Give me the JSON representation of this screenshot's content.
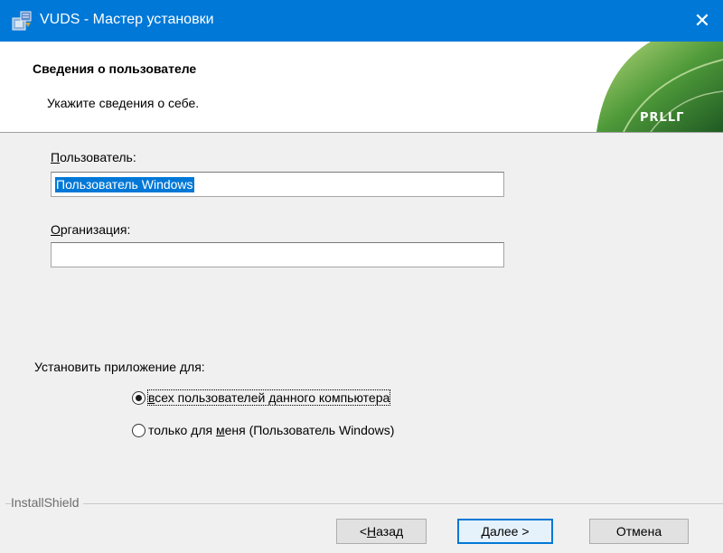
{
  "window": {
    "title": "VUDS - Мастер установки",
    "close_glyph": "✕",
    "accent": "#0078d7",
    "icons": [
      "installer-app-icon",
      "close-icon"
    ]
  },
  "header": {
    "title": "Сведения о пользователе",
    "subtitle": "Укажите сведения о себе.",
    "logo_text": "PRLLГ"
  },
  "form": {
    "user": {
      "label_accel": "П",
      "label_rest": "ользователь:",
      "value": "Пользователь Windows"
    },
    "org": {
      "label_accel": "О",
      "label_rest": "рганизация:",
      "value": ""
    }
  },
  "install_for": {
    "label": "Установить приложение для:",
    "options": [
      {
        "accel": "в",
        "rest": "сех пользователей данного компьютера",
        "checked": true
      },
      {
        "before": "только для ",
        "accel": "м",
        "rest": "еня (Пользователь Windows)",
        "checked": false
      }
    ]
  },
  "footer": {
    "brand": "InstallShield",
    "back": {
      "prefix": "< ",
      "accel": "Н",
      "rest": "азад"
    },
    "next": {
      "accel": "Д",
      "rest": "алее >"
    },
    "cancel": "Отмена"
  }
}
